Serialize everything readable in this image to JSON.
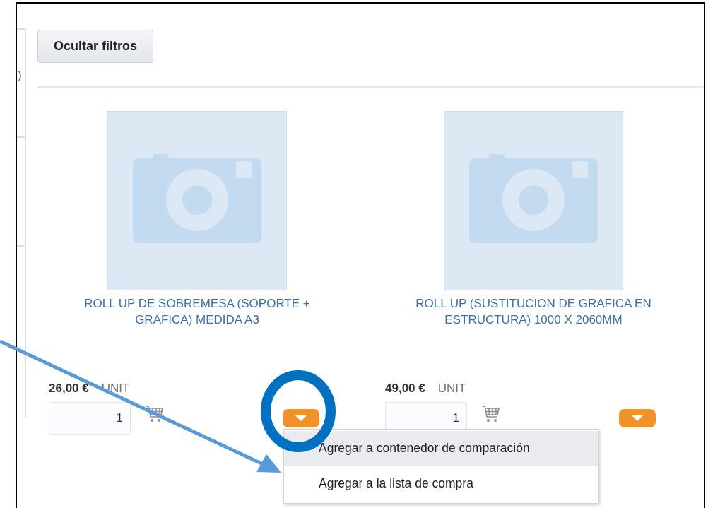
{
  "sidebar": {
    "text_fragment": ")"
  },
  "hide_filters_button": "Ocultar filtros",
  "products": [
    {
      "title": "ROLL UP DE SOBREMESA (SOPORTE + GRAFICA) MEDIDA A3",
      "price": "26,00 €",
      "unit": "UNIT",
      "quantity": "1",
      "menu_open": true
    },
    {
      "title": "ROLL UP (SUSTITUCION DE GRAFICA EN ESTRUCTURA) 1000 X 2060MM",
      "price": "49,00 €",
      "unit": "UNIT",
      "quantity": "1",
      "menu_open": false
    }
  ],
  "dropdown_menu": {
    "items": [
      {
        "label": "Agregar a contenedor de comparación",
        "selected": true
      },
      {
        "label": "Agregar a la lista de compra",
        "selected": false
      }
    ]
  }
}
